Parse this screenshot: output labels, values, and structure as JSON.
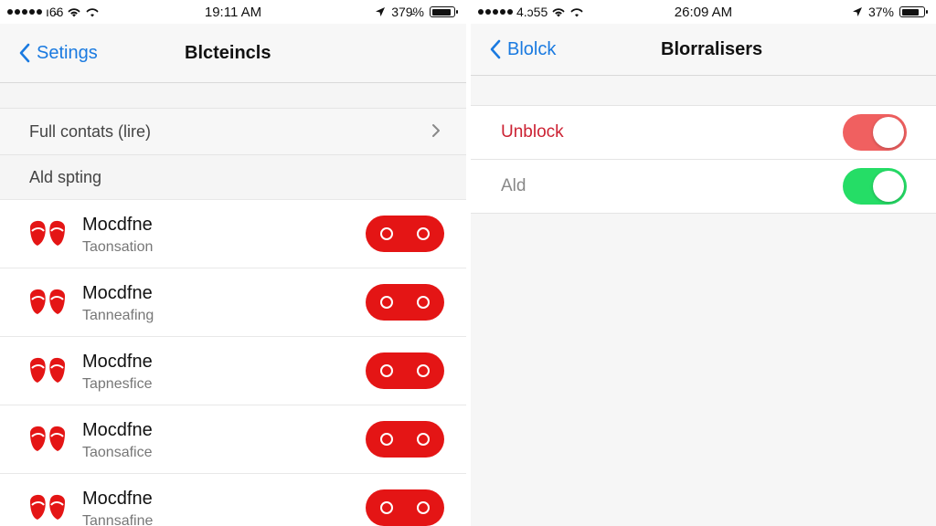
{
  "left_screen": {
    "status": {
      "signal_text": "ı6̵6",
      "time": "19:11 AM",
      "battery": "379̵%"
    },
    "nav": {
      "back_label": "Setings",
      "title": "Blcteincls"
    },
    "full_contacts_row": {
      "label": "Full contats (lire)"
    },
    "section_label": "Ald spting",
    "contacts": [
      {
        "name": "Mocdfne",
        "subtitle": "Taonsation"
      },
      {
        "name": "Mocdfne",
        "subtitle": "Tanneafing"
      },
      {
        "name": "Mocdfne",
        "subtitle": "Tapnesfice"
      },
      {
        "name": "Mocdfne",
        "subtitle": "Taonsafice"
      },
      {
        "name": "Mocdfne",
        "subtitle": "Tannsafine"
      }
    ],
    "icons": {
      "back": "chevron-left-icon",
      "row_arrow": "chevron-right-icon",
      "avatar": "red-mask-icon",
      "toggle": "red-pill-toggle"
    }
  },
  "right_screen": {
    "status": {
      "signal_text": "4.ↄ55",
      "time": "26:09 AM",
      "battery": "37%"
    },
    "nav": {
      "back_label": "Blolck",
      "title": "Blorralisers"
    },
    "rows": [
      {
        "label": "Unblock",
        "toggle": "on",
        "color": "#f06060"
      },
      {
        "label": "Ald",
        "toggle": "on",
        "color": "#25dd66"
      }
    ]
  },
  "colors": {
    "accent_blue": "#1a7ae0",
    "block_red": "#e41515",
    "unblock_red": "#cc2233",
    "toggle_green": "#25dd66"
  }
}
